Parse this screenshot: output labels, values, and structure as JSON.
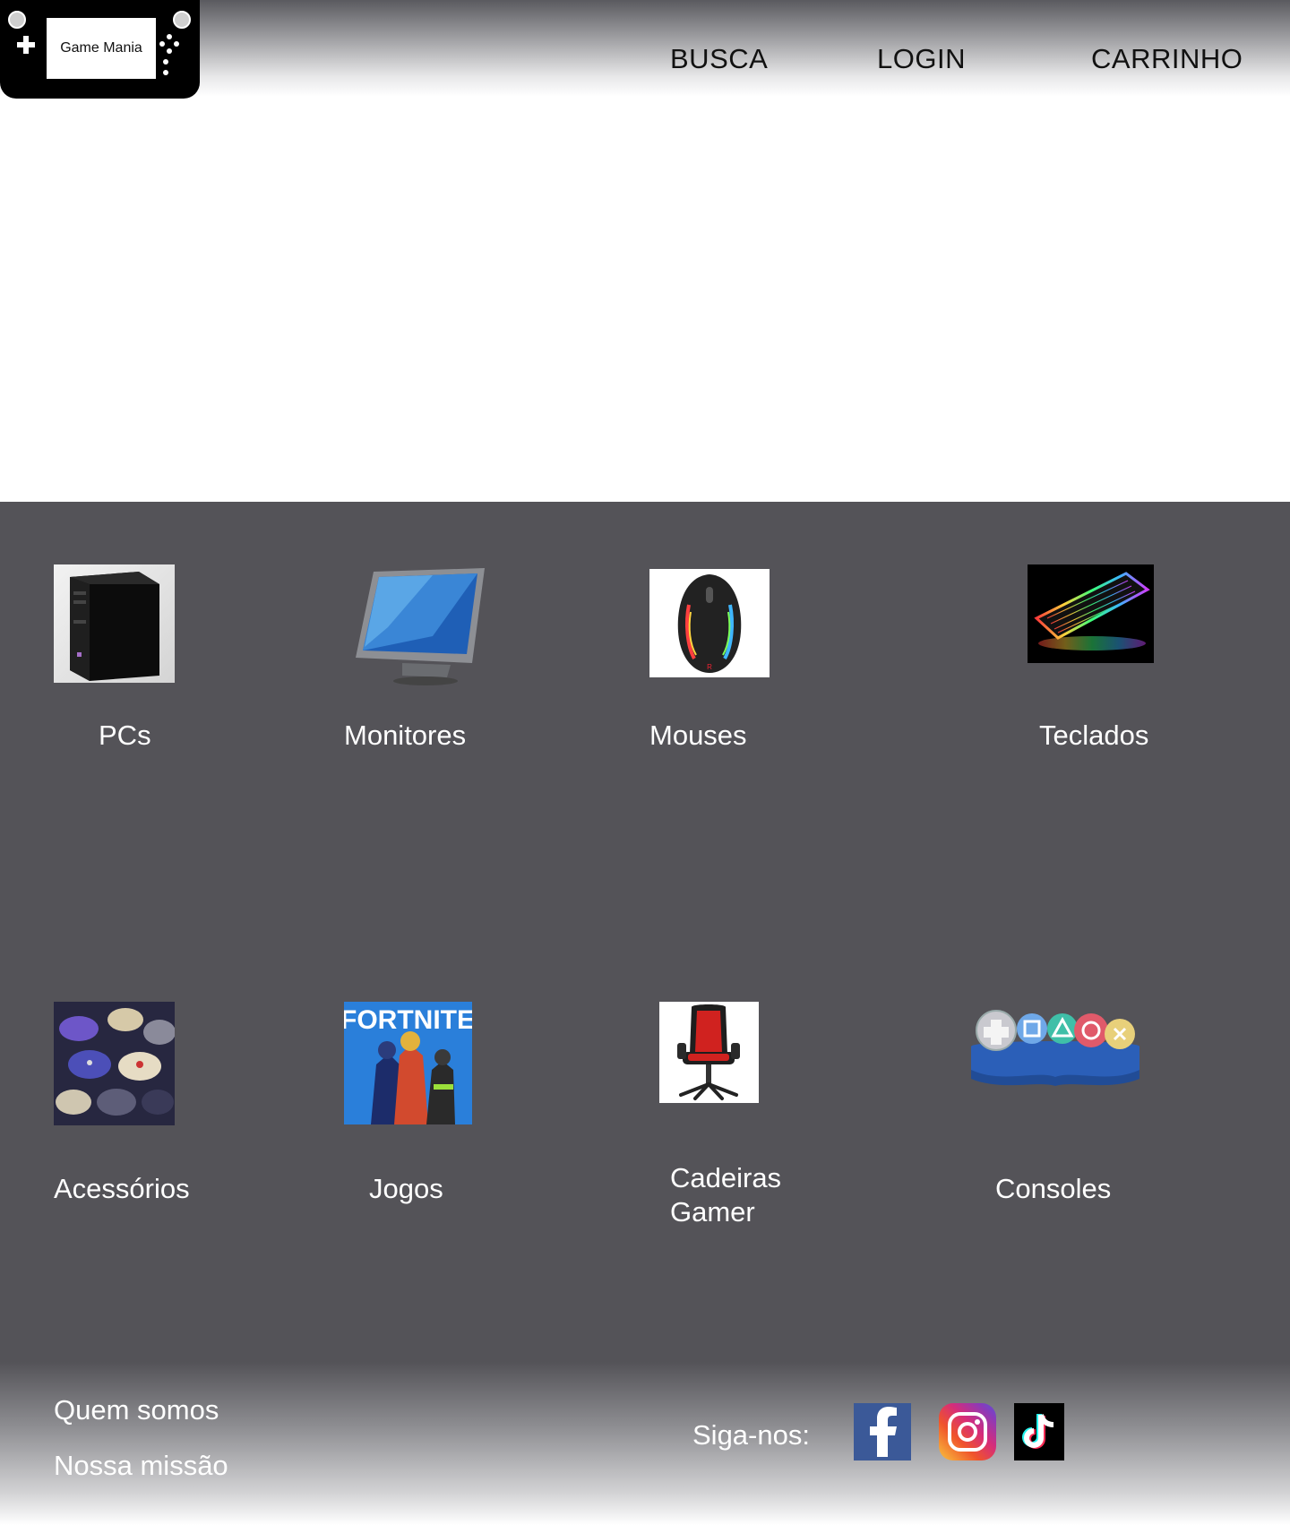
{
  "header": {
    "logo_text": "Game Mania",
    "nav": {
      "search": "BUSCA",
      "login": "LOGIN",
      "cart": "CARRINHO"
    }
  },
  "categories": [
    {
      "label": "PCs",
      "icon": "pc-tower-icon"
    },
    {
      "label": "Monitores",
      "icon": "monitor-icon"
    },
    {
      "label": "Mouses",
      "icon": "mouse-icon"
    },
    {
      "label": "Teclados",
      "icon": "keyboard-icon"
    },
    {
      "label": "Acessórios",
      "icon": "controllers-icon"
    },
    {
      "label": "Jogos",
      "icon": "fortnite-cover-icon"
    },
    {
      "label": "Cadeiras Gamer",
      "label_line1": "Cadeiras",
      "label_line2": "Gamer",
      "icon": "gaming-chair-icon"
    },
    {
      "label": "Consoles",
      "icon": "console-buttons-icon"
    }
  ],
  "fortnite_logo": "FORTNITE",
  "footer": {
    "about": "Quem somos",
    "mission": "Nossa missão",
    "follow_label": "Siga-nos:",
    "social": [
      "facebook-icon",
      "instagram-icon",
      "tiktok-icon"
    ]
  },
  "colors": {
    "category_bg": "#545358",
    "facebook": "#3b5998",
    "tiktok_bg": "#000000"
  }
}
